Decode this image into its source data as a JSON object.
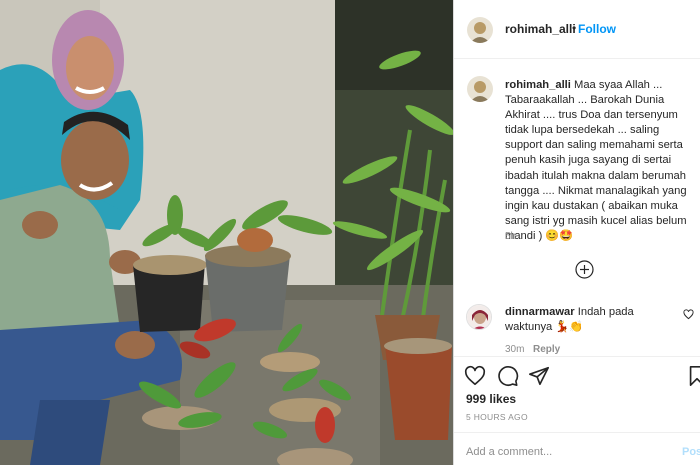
{
  "post": {
    "username": "rohimah_alli",
    "separator": "•",
    "follow_label": "Follow",
    "caption_user": "rohimah_alli",
    "caption_text": "Maa syaa Allah ... Tabaraakallah ... Barokah Dunia Akhirat .... trus Doa dan tersenyum tidak lupa bersedekah ... saling support dan saling memahami serta penuh kasih juga sayang di sertai ibadah itulah makna dalam berumah tangga .... Nikmat manalagikah yang ingin kau dustakan ( abaikan muka sang istri yg masih kucel alias belum mandi ) 😊🤩",
    "caption_time": "5h",
    "likes": "999 likes",
    "posted": "5 HOURS AGO"
  },
  "comment": {
    "username": "dinnarmawar",
    "text": "Indah pada waktunya 💃👏",
    "time": "30m",
    "reply_label": "Reply"
  },
  "add_comment": {
    "placeholder": "Add a comment...",
    "post_label": "Post"
  },
  "icons": {
    "like": "heart-icon",
    "comment": "comment-icon",
    "share": "share-icon",
    "save": "bookmark-icon",
    "load_more": "plus-circle-icon",
    "comment_like": "small-heart-icon"
  },
  "colors": {
    "link": "#0095f6",
    "secondary_text": "#8e8e8e",
    "post_button_disabled": "#b2dffc"
  }
}
